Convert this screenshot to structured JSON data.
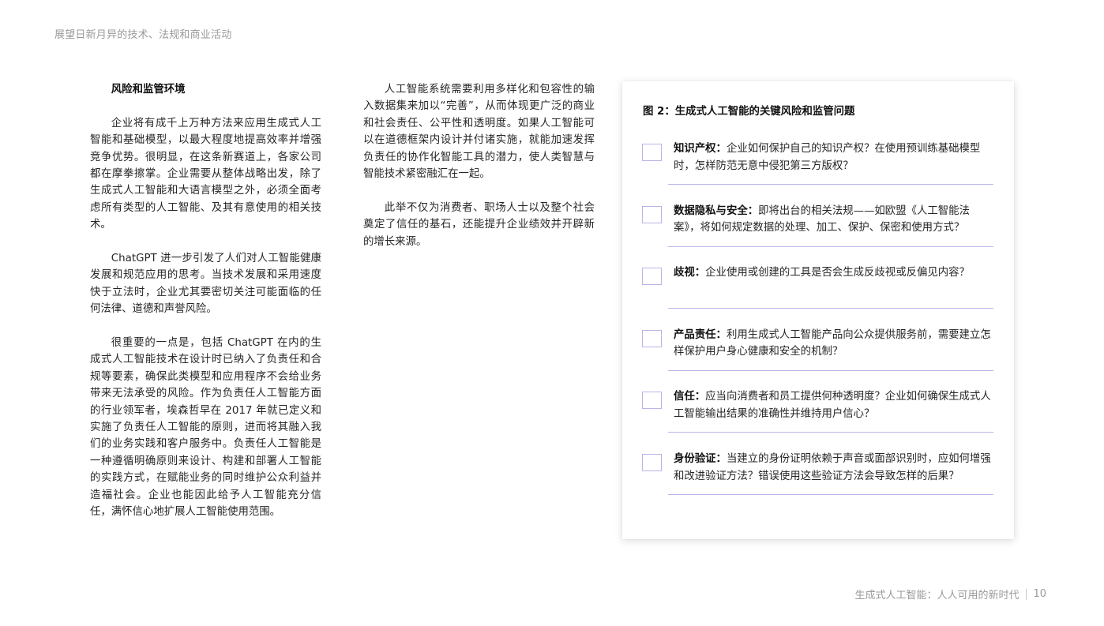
{
  "header": {
    "running_title": "展望日新月异的技术、法规和商业活动"
  },
  "column1": {
    "heading": "风险和监管环境",
    "paragraphs": [
      "企业将有成千上万种方法来应用生成式人工智能和基础模型，以最大程度地提高效率并增强竞争优势。很明显，在这条新赛道上，各家公司都在摩拳擦掌。企业需要从整体战略出发，除了生成式人工智能和大语言模型之外，必须全面考虑所有类型的人工智能、及其有意使用的相关技术。",
      "ChatGPT 进一步引发了人们对人工智能健康发展和规范应用的思考。当技术发展和采用速度快于立法时，企业尤其要密切关注可能面临的任何法律、道德和声誉风险。",
      "很重要的一点是，包括 ChatGPT 在内的生成式人工智能技术在设计时已纳入了负责任和合规等要素，确保此类模型和应用程序不会给业务带来无法承受的风险。作为负责任人工智能方面的行业领军者，埃森哲早在 2017 年就已定义和实施了负责任人工智能的原则，进而将其融入我们的业务实践和客户服务中。负责任人工智能是一种遵循明确原则来设计、构建和部署人工智能的实践方式，在赋能业务的同时维护公众利益并造福社会。企业也能因此给予人工智能充分信任，满怀信心地扩展人工智能使用范围。"
    ]
  },
  "column2": {
    "paragraphs": [
      "人工智能系统需要利用多样化和包容性的输入数据集来加以“完善”，从而体现更广泛的商业和社会责任、公平性和透明度。如果人工智能可以在道德框架内设计并付诸实施，就能加速发挥负责任的协作化智能工具的潜力，使人类智慧与智能技术紧密融汇在一起。",
      "此举不仅为消费者、职场人士以及整个社会奠定了信任的基石，还能提升企业绩效并开辟新的增长来源。"
    ]
  },
  "figure": {
    "title": "图 2：生成式人工智能的关键风险和监管问题",
    "items": [
      {
        "label": "知识产权：",
        "text": "企业如何保护自己的知识产权？在使用预训练基础模型时，怎样防范无意中侵犯第三方版权？"
      },
      {
        "label": "数据隐私与安全：",
        "text": "即将出台的相关法规——如欧盟《人工智能法案》，将如何规定数据的处理、加工、保护、保密和使用方式？"
      },
      {
        "label": "歧视：",
        "text": "企业使用或创建的工具是否会生成反歧视或反偏见内容？"
      },
      {
        "label": "产品责任：",
        "text": "利用生成式人工智能产品向公众提供服务前，需要建立怎样保护用户身心健康和安全的机制？"
      },
      {
        "label": "信任：",
        "text": "应当向消费者和员工提供何种透明度？企业如何确保生成式人工智能输出结果的准确性并维持用户信心？"
      },
      {
        "label": "身份验证：",
        "text": "当建立的身份证明依赖于声音或面部识别时，应如何增强和改进验证方法？错误使用这些验证方法会导致怎样的后果？"
      }
    ],
    "accent_color": "#b9b6e8"
  },
  "footer": {
    "publication_title": "生成式人工智能：人人可用的新时代",
    "page_number": "10"
  }
}
